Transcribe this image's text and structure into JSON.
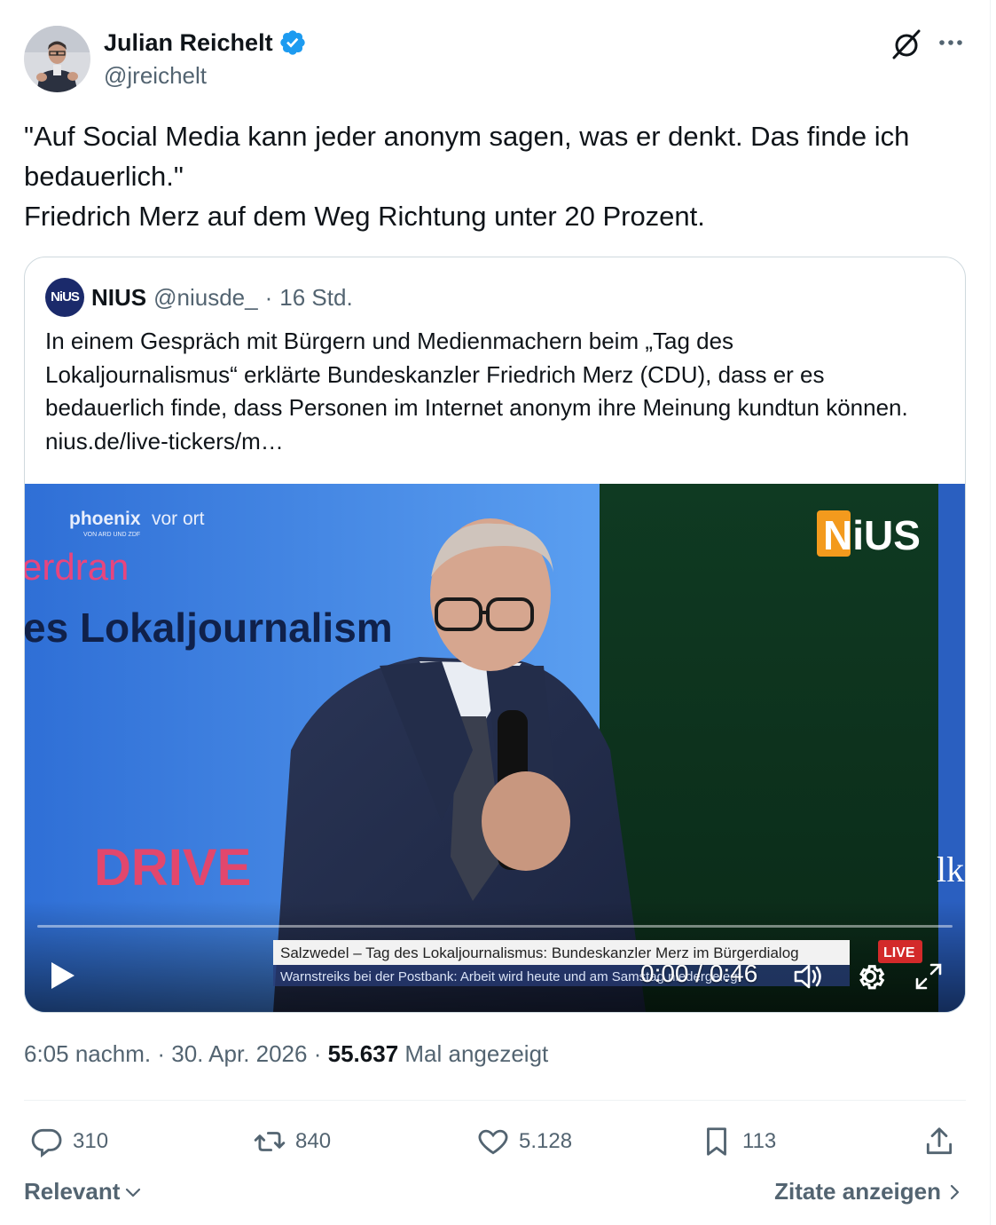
{
  "author": {
    "name": "Julian Reichelt",
    "handle": "@jreichelt",
    "verified": true
  },
  "tweet": {
    "line1": "\"Auf Social Media kann jeder anonym sagen, was er denkt. Das finde ich bedauerlich.\"",
    "line2": "Friedrich Merz auf dem Weg Richtung unter 20 Prozent."
  },
  "quote": {
    "avatar_text": "NiUS",
    "name": "NIUS",
    "handle": "@niusde_",
    "separator": "·",
    "time": "16 Std.",
    "text": "In einem Gespräch mit Bürgern und Medienmachern beim „Tag des Lokaljournalismus“ erklärte Bundeskanzler Friedrich Merz (CDU), dass er es bedauerlich finde, dass Personen im Internet anonym ihre Meinung kundtun können. nius.de/live-tickers/m…"
  },
  "video": {
    "time": "0:00 / 0:46",
    "progress": 0,
    "overlay": {
      "channel": "phoenix",
      "channel_suffix": "vor ort",
      "channel_sub": "VON ARD UND ZDF",
      "backdrop_line1": "erdran",
      "backdrop_line2": "es Lokaljournalism",
      "sponsor": "DRIVE",
      "logo": "NiUS",
      "ticker_top": "Salzwedel – Tag des Lokaljournalismus: Bundeskanzler Merz im Bürgerdialog",
      "ticker_bottom": "Warnstreiks bei der Postbank: Arbeit wird heute und am Samstag niedergelegt",
      "live": "LIVE",
      "edge_text": "lk"
    }
  },
  "meta": {
    "time": "6:05 nachm.",
    "sep": "·",
    "date": "30. Apr. 2026",
    "views": "55.637",
    "views_label": "Mal angezeigt"
  },
  "actions": {
    "replies": "310",
    "reposts": "840",
    "likes": "5.128",
    "bookmarks": "113"
  },
  "footer": {
    "sort": "Relevant",
    "quotes": "Zitate anzeigen"
  },
  "colors": {
    "text": "#0f1419",
    "secondary": "#536471",
    "verified": "#1d9bf0",
    "border": "#cfd9de"
  }
}
